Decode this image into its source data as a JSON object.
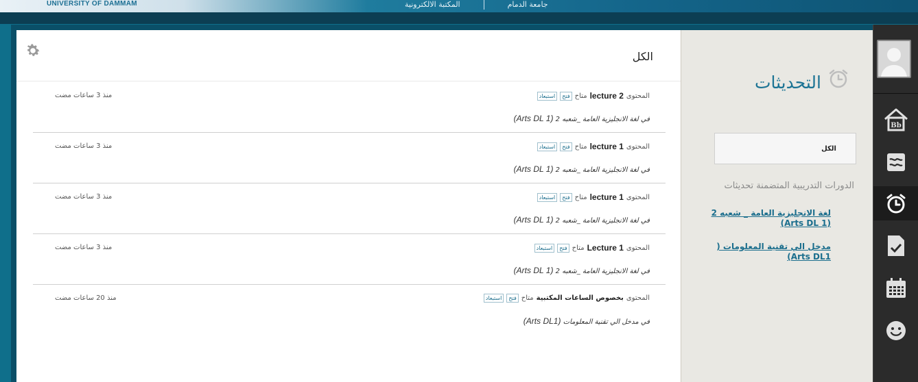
{
  "header": {
    "university": "UNIVERSITY OF DAMMAM",
    "links": [
      "جامعة الدمام",
      "المكتبة الالكترونية"
    ]
  },
  "main": {
    "title": "الكل",
    "updates": [
      {
        "type": "المحتوى",
        "name": "lecture 2",
        "status": "متاح",
        "open": "فتح",
        "dismiss": "استبعاد",
        "course": "في لغة الانجليزية العامة _شعبه 2",
        "course_latin": "(Arts DL 1)",
        "time": "منذ 3 ساعات مضت"
      },
      {
        "type": "المحتوى",
        "name": "lecture 1",
        "status": "متاح",
        "open": "فتح",
        "dismiss": "استبعاد",
        "course": "في لغة الانجليزية العامة _شعبه 2",
        "course_latin": "(Arts DL 1)",
        "time": "منذ 3 ساعات مضت"
      },
      {
        "type": "المحتوى",
        "name": "lecture 1",
        "status": "متاح",
        "open": "فتح",
        "dismiss": "استبعاد",
        "course": "في لغة الانجليزية العامة _شعبه 2",
        "course_latin": "(Arts DL 1)",
        "time": "منذ 3 ساعات مضت"
      },
      {
        "type": "المحتوى",
        "name": "Lecture 1",
        "status": "متاح",
        "open": "فتح",
        "dismiss": "استبعاد",
        "course": "في لغة الانجليزية العامة _شعبه 2",
        "course_latin": "(Arts DL 1)",
        "time": "منذ 3 ساعات مضت"
      },
      {
        "type": "المحتوى",
        "name": "بخصوص الساعات المكتبية",
        "status": "متاح",
        "open": "فتح",
        "dismiss": "استبعاد",
        "course": "في مدخل الي تقنية المعلومات",
        "course_latin": "(Arts DL1)",
        "time": "منذ 20 ساعات مضت"
      }
    ]
  },
  "sidebar": {
    "title": "التحديثات",
    "filter_all": "الكل",
    "courses_label": "الدورات التدريبية المتضمنة تحديثات",
    "courses": [
      {
        "line1": "لغة الانجليزية العامة _ شعبه 2",
        "line2": "(Arts DL 1)"
      },
      {
        "line1": "مدخل الي تقنية المعلومات (",
        "line2": "Arts DL1)"
      }
    ]
  },
  "rail": {
    "items": [
      "home-bb-icon",
      "stream-icon",
      "updates-clock-icon",
      "grades-icon",
      "calendar-icon",
      "profile-smiley-icon"
    ],
    "active": "updates-clock-icon"
  }
}
